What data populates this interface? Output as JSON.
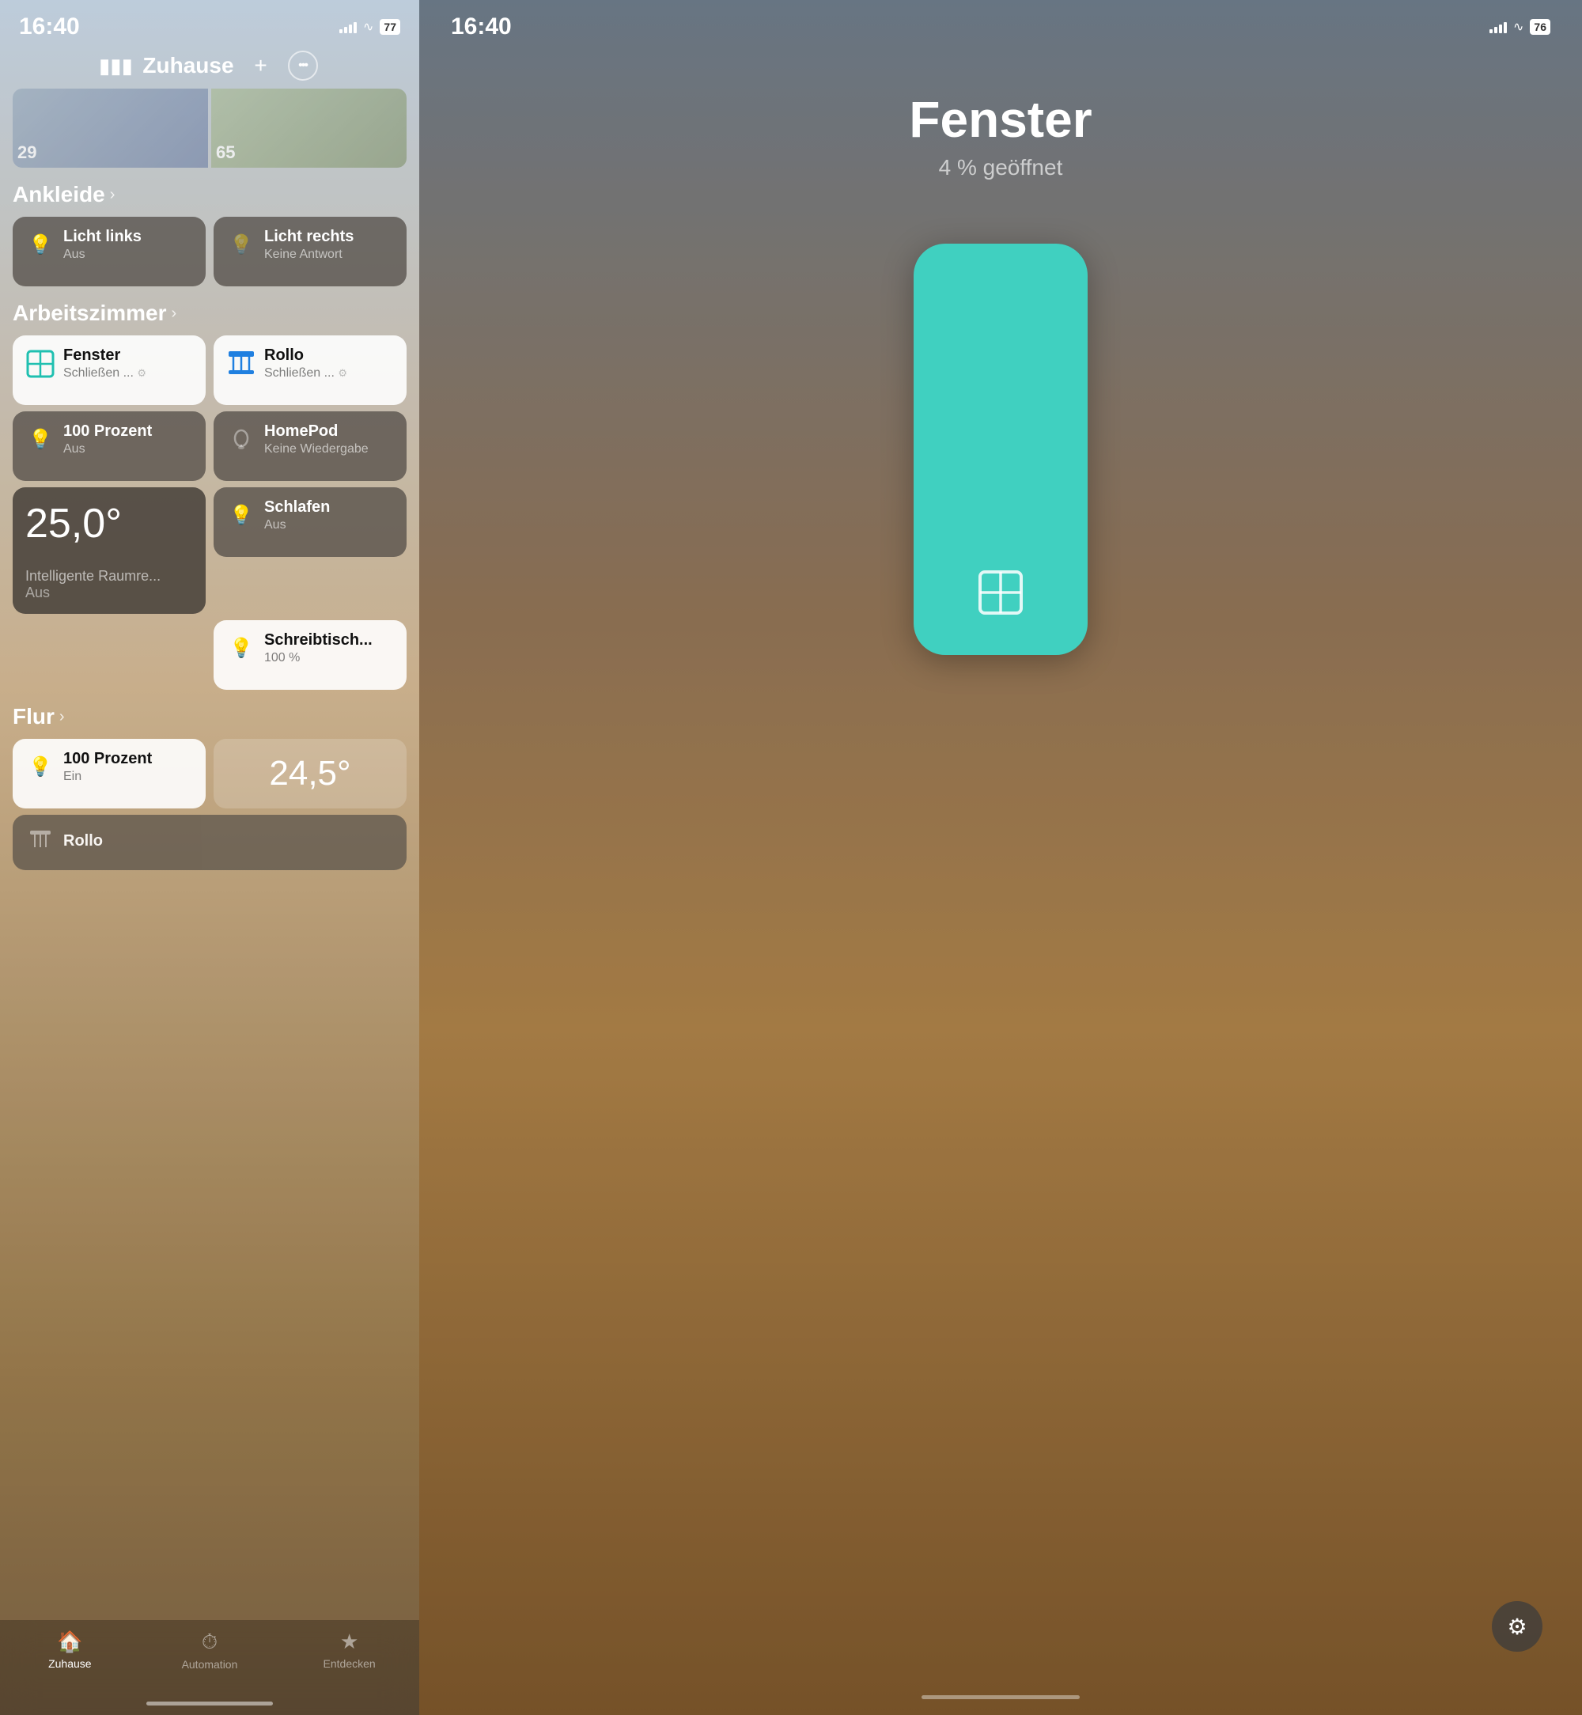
{
  "left": {
    "status": {
      "time": "16:40",
      "battery": "77"
    },
    "header": {
      "title": "Zuhause",
      "add_label": "+",
      "more_label": "···"
    },
    "top_strip": {
      "item1": "29",
      "item2": "65"
    },
    "sections": [
      {
        "id": "ankleide",
        "title": "Ankleide",
        "devices": [
          {
            "id": "licht-links",
            "name": "Licht links",
            "status": "Aus",
            "theme": "dark",
            "icon": "💡",
            "icon_color": "#e8c040"
          },
          {
            "id": "licht-rechts",
            "name": "Licht rechts",
            "status": "Keine Antwort",
            "theme": "dark",
            "icon": "💡",
            "icon_color": "rgba(255,255,255,0.4)"
          }
        ]
      },
      {
        "id": "arbeitszimmer",
        "title": "Arbeitszimmer",
        "devices": [
          {
            "id": "fenster",
            "name": "Fenster",
            "status": "Schließen ...",
            "theme": "light",
            "icon": "window",
            "icon_color": "#20c0b0",
            "has_spinner": true
          },
          {
            "id": "rollo",
            "name": "Rollo",
            "status": "Schließen ...",
            "theme": "light",
            "icon": "rollo",
            "icon_color": "#2080e0",
            "has_spinner": true
          },
          {
            "id": "100-prozent",
            "name": "100 Prozent",
            "status": "Aus",
            "theme": "dark",
            "icon": "💡",
            "icon_color": "#e8c040"
          },
          {
            "id": "homepod",
            "name": "HomePod",
            "status": "Keine Wiedergabe",
            "theme": "dark",
            "icon": "homepod",
            "icon_color": "rgba(255,255,255,0.4)"
          },
          {
            "id": "temp-tile",
            "name": "Intelligente Raumre...",
            "temp": "25,0°",
            "status": "Aus",
            "theme": "temp"
          },
          {
            "id": "schlafen",
            "name": "Schlafen",
            "status": "Aus",
            "theme": "dark",
            "icon": "💡",
            "icon_color": "#e8c040"
          },
          {
            "id": "schreibtisch",
            "name": "Schreibtisch...",
            "status": "100 %",
            "theme": "light",
            "icon": "💡",
            "icon_color": "#f0b800"
          }
        ]
      },
      {
        "id": "flur",
        "title": "Flur",
        "devices": [
          {
            "id": "flur-100prozent",
            "name": "100 Prozent",
            "status": "Ein",
            "theme": "light",
            "icon": "💡",
            "icon_color": "#f0b800"
          },
          {
            "id": "flur-temp",
            "temp": "24,5°",
            "theme": "temp-inline"
          },
          {
            "id": "rollo-flur",
            "name": "Rollo",
            "status": "...",
            "theme": "dark"
          }
        ]
      }
    ],
    "nav": {
      "items": [
        {
          "id": "zuhause",
          "label": "Zuhause",
          "icon": "🏠",
          "active": true
        },
        {
          "id": "automation",
          "label": "Automation",
          "icon": "⏱",
          "active": false
        },
        {
          "id": "entdecken",
          "label": "Entdecken",
          "icon": "★",
          "active": false
        }
      ]
    }
  },
  "right": {
    "status": {
      "time": "16:40",
      "battery": "76"
    },
    "detail": {
      "title": "Fenster",
      "subtitle": "4 % geöffnet"
    },
    "window_device": {
      "color": "#40d0c0"
    },
    "gear_button_label": "⚙"
  }
}
